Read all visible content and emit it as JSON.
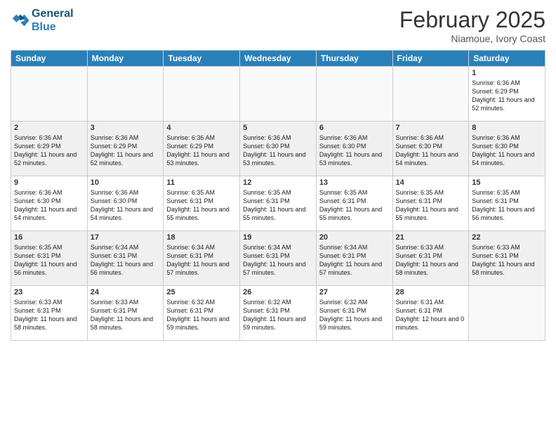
{
  "logo": {
    "line1": "General",
    "line2": "Blue"
  },
  "title": "February 2025",
  "subtitle": "Niamoue, Ivory Coast",
  "days_of_week": [
    "Sunday",
    "Monday",
    "Tuesday",
    "Wednesday",
    "Thursday",
    "Friday",
    "Saturday"
  ],
  "weeks": [
    [
      {
        "day": "",
        "info": ""
      },
      {
        "day": "",
        "info": ""
      },
      {
        "day": "",
        "info": ""
      },
      {
        "day": "",
        "info": ""
      },
      {
        "day": "",
        "info": ""
      },
      {
        "day": "",
        "info": ""
      },
      {
        "day": "1",
        "info": "Sunrise: 6:36 AM\nSunset: 6:29 PM\nDaylight: 11 hours and 52 minutes."
      }
    ],
    [
      {
        "day": "2",
        "info": "Sunrise: 6:36 AM\nSunset: 6:29 PM\nDaylight: 11 hours and 52 minutes."
      },
      {
        "day": "3",
        "info": "Sunrise: 6:36 AM\nSunset: 6:29 PM\nDaylight: 11 hours and 52 minutes."
      },
      {
        "day": "4",
        "info": "Sunrise: 6:36 AM\nSunset: 6:29 PM\nDaylight: 11 hours and 53 minutes."
      },
      {
        "day": "5",
        "info": "Sunrise: 6:36 AM\nSunset: 6:30 PM\nDaylight: 11 hours and 53 minutes."
      },
      {
        "day": "6",
        "info": "Sunrise: 6:36 AM\nSunset: 6:30 PM\nDaylight: 11 hours and 53 minutes."
      },
      {
        "day": "7",
        "info": "Sunrise: 6:36 AM\nSunset: 6:30 PM\nDaylight: 11 hours and 54 minutes."
      },
      {
        "day": "8",
        "info": "Sunrise: 6:36 AM\nSunset: 6:30 PM\nDaylight: 11 hours and 54 minutes."
      }
    ],
    [
      {
        "day": "9",
        "info": "Sunrise: 6:36 AM\nSunset: 6:30 PM\nDaylight: 11 hours and 54 minutes."
      },
      {
        "day": "10",
        "info": "Sunrise: 6:36 AM\nSunset: 6:30 PM\nDaylight: 11 hours and 54 minutes."
      },
      {
        "day": "11",
        "info": "Sunrise: 6:35 AM\nSunset: 6:31 PM\nDaylight: 11 hours and 55 minutes."
      },
      {
        "day": "12",
        "info": "Sunrise: 6:35 AM\nSunset: 6:31 PM\nDaylight: 11 hours and 55 minutes."
      },
      {
        "day": "13",
        "info": "Sunrise: 6:35 AM\nSunset: 6:31 PM\nDaylight: 11 hours and 55 minutes."
      },
      {
        "day": "14",
        "info": "Sunrise: 6:35 AM\nSunset: 6:31 PM\nDaylight: 11 hours and 55 minutes."
      },
      {
        "day": "15",
        "info": "Sunrise: 6:35 AM\nSunset: 6:31 PM\nDaylight: 11 hours and 56 minutes."
      }
    ],
    [
      {
        "day": "16",
        "info": "Sunrise: 6:35 AM\nSunset: 6:31 PM\nDaylight: 11 hours and 56 minutes."
      },
      {
        "day": "17",
        "info": "Sunrise: 6:34 AM\nSunset: 6:31 PM\nDaylight: 11 hours and 56 minutes."
      },
      {
        "day": "18",
        "info": "Sunrise: 6:34 AM\nSunset: 6:31 PM\nDaylight: 11 hours and 57 minutes."
      },
      {
        "day": "19",
        "info": "Sunrise: 6:34 AM\nSunset: 6:31 PM\nDaylight: 11 hours and 57 minutes."
      },
      {
        "day": "20",
        "info": "Sunrise: 6:34 AM\nSunset: 6:31 PM\nDaylight: 11 hours and 57 minutes."
      },
      {
        "day": "21",
        "info": "Sunrise: 6:33 AM\nSunset: 6:31 PM\nDaylight: 11 hours and 58 minutes."
      },
      {
        "day": "22",
        "info": "Sunrise: 6:33 AM\nSunset: 6:31 PM\nDaylight: 11 hours and 58 minutes."
      }
    ],
    [
      {
        "day": "23",
        "info": "Sunrise: 6:33 AM\nSunset: 6:31 PM\nDaylight: 11 hours and 58 minutes."
      },
      {
        "day": "24",
        "info": "Sunrise: 6:33 AM\nSunset: 6:31 PM\nDaylight: 11 hours and 58 minutes."
      },
      {
        "day": "25",
        "info": "Sunrise: 6:32 AM\nSunset: 6:31 PM\nDaylight: 11 hours and 59 minutes."
      },
      {
        "day": "26",
        "info": "Sunrise: 6:32 AM\nSunset: 6:31 PM\nDaylight: 11 hours and 59 minutes."
      },
      {
        "day": "27",
        "info": "Sunrise: 6:32 AM\nSunset: 6:31 PM\nDaylight: 11 hours and 59 minutes."
      },
      {
        "day": "28",
        "info": "Sunrise: 6:31 AM\nSunset: 6:31 PM\nDaylight: 12 hours and 0 minutes."
      },
      {
        "day": "",
        "info": ""
      }
    ]
  ]
}
